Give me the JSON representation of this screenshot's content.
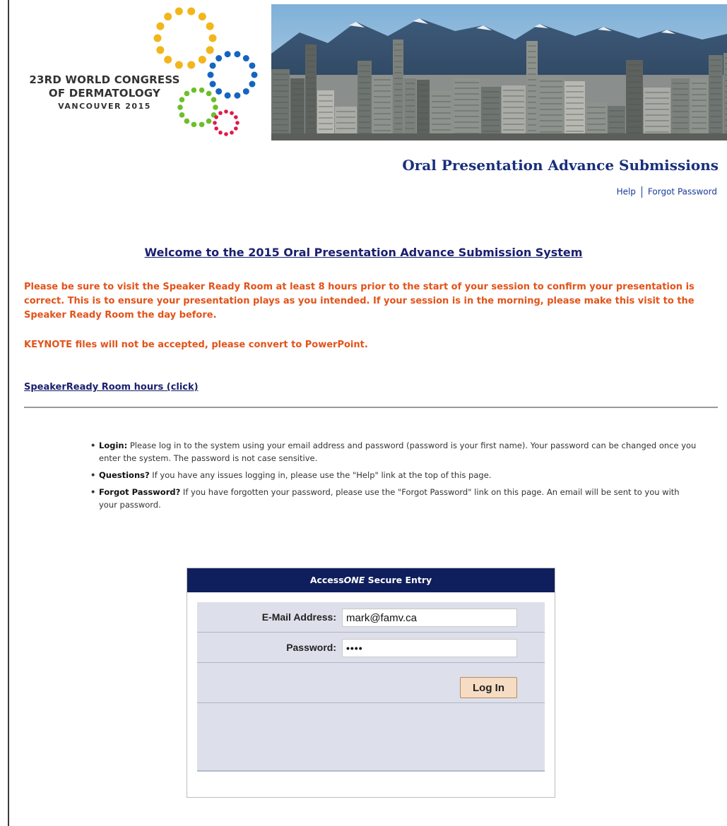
{
  "header": {
    "logo_line1": "23RD WORLD CONGRESS",
    "logo_line2": "OF DERMATOLOGY",
    "logo_line3": "VANCOUVER 2015"
  },
  "title": "Oral Presentation Advance Submissions",
  "links": {
    "help": "Help",
    "forgot": "Forgot Password"
  },
  "welcome": "Welcome to the 2015 Oral Presentation Advance Submission System",
  "warning": "Please be sure to visit the Speaker Ready Room at least 8 hours prior to the start of your session to confirm your presentation is correct. This is to ensure your presentation plays as you intended. If your session is in the morning, please make this visit to the Speaker Ready Room the day before.",
  "keynote": "KEYNOTE files will not be accepted, please convert to PowerPoint.",
  "hours_link": "SpeakerReady Room hours (click)",
  "bullets": [
    {
      "term": "Login:",
      "text": " Please log in to the system using your email address and password (password is your first name). Your password can be changed once you enter the system. The password is not case sensitive."
    },
    {
      "term": "Questions?",
      "text": " If you have any issues logging in, please use the \"Help\" link at the top of this page."
    },
    {
      "term": "Forgot Password?",
      "text": " If you have forgotten your password, please use the \"Forgot Password\" link on this page. An email will be sent to you with your password."
    }
  ],
  "login": {
    "heading_prefix": "Access",
    "heading_italic": "ONE",
    "heading_suffix": " Secure Entry",
    "email_label": "E-Mail Address:",
    "email_value": "mark@famv.ca",
    "password_label": "Password:",
    "password_value": "••••",
    "button": "Log In"
  },
  "colors": {
    "title": "#1a2f7a",
    "warning": "#e2531a",
    "login_header": "#0f1e5c",
    "login_panel": "#dde0ea",
    "button": "#f6dcc2"
  }
}
